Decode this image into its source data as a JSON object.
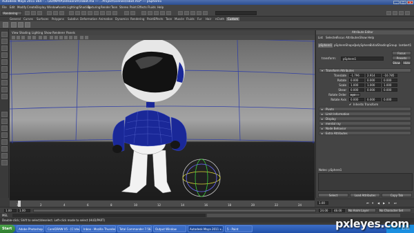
{
  "window": {
    "title": "Autodesk Maya 2011 x64 - ...\\3D\\MAYA\\ednaanim\\robot.ma  ---  ...Project\\scenes\\robot.ma*  ---  pSphere1",
    "min": "_",
    "max": "□",
    "close": "✕"
  },
  "menus": [
    "File",
    "Edit",
    "Modify",
    "Create",
    "Display",
    "Window",
    "Assets",
    "Lighting/Shading",
    "Texturing",
    "Render",
    "Toon",
    "Stereo",
    "Paint Effects",
    "Fluids",
    "Help"
  ],
  "mode": "Rendering",
  "shelf_tabs": [
    "General",
    "Curves",
    "Surfaces",
    "Polygons",
    "Subdivs",
    "Deformation",
    "Animation",
    "Dynamics",
    "Rendering",
    "PaintEffects",
    "Toon",
    "Muscle",
    "Fluids",
    "Fur",
    "Hair",
    "nCloth",
    "Custom"
  ],
  "active_shelf_tab": "Custom",
  "panel_menu": [
    "View",
    "Shading",
    "Lighting",
    "Show",
    "Renderer",
    "Panels"
  ],
  "attr_editor": {
    "title": "Attribute Editor",
    "menu": [
      "List",
      "Selected",
      "Focus",
      "Attributes",
      "Show",
      "Help"
    ],
    "tabs": [
      "pSphere1",
      "pSphereShape1",
      "polySphere1",
      "initialShadingGroup",
      "lambert1"
    ],
    "node_label": "transform:",
    "node_value": "pSphere1",
    "focus_btn": "Focus",
    "presets_btn": "Presets",
    "show_btn": "Show",
    "hide_btn": "Hide",
    "section_open": "Transform Attributes",
    "rows": [
      {
        "label": "Translate",
        "v": [
          "-1.796",
          "2.914",
          "-10.785"
        ]
      },
      {
        "label": "Rotate",
        "v": [
          "0.000",
          "0.000",
          "0.000"
        ]
      },
      {
        "label": "Scale",
        "v": [
          "1.000",
          "1.000",
          "1.000"
        ]
      },
      {
        "label": "Shear",
        "v": [
          "0.000",
          "0.000",
          "0.000"
        ]
      },
      {
        "label": "Rotate Order",
        "v": [
          "xyz"
        ]
      },
      {
        "label": "Rotate Axis",
        "v": [
          "0.000",
          "0.000",
          "0.000"
        ]
      }
    ],
    "inherits": "Inherits Transform",
    "closed_sections": [
      "Pivots",
      "Limit Information",
      "Display",
      "mental ray",
      "Node Behavior",
      "Extra Attributes"
    ],
    "notes_label": "Notes: pSphere1",
    "buttons": [
      "Select",
      "Load Attributes",
      "Copy Tab"
    ]
  },
  "time": {
    "ticks": [
      "1",
      "2",
      "4",
      "6",
      "8",
      "10",
      "12",
      "14",
      "16",
      "18",
      "20",
      "22",
      "24"
    ],
    "current": "1.00"
  },
  "range": {
    "start": "1.00",
    "inner_start": "1.00",
    "inner_end": "24.00",
    "end": "48.00",
    "anim_layer": "No Anim Layer",
    "char_set": "No Character Set"
  },
  "cmd": {
    "label": "MEL"
  },
  "help": "Double-click; Shift to select/deselect. Left-click mode to select (HUD/PART)",
  "taskbar": {
    "start": "Start",
    "items": [
      "Adobe Photoshop",
      "CorelDRAW X5 - [C:\\doc...",
      "Inbox - Mozilla Thunderbird",
      "Total Commander 7.56a",
      "Output Window",
      "Autodesk Maya 2011 x...",
      "5 - Paint"
    ],
    "clock": "12:04"
  },
  "watermark": "pxleyes.com",
  "colors": {
    "accent": "#2b3aa8",
    "body": "#1a2898",
    "white_parts": "#f2f2f2"
  }
}
